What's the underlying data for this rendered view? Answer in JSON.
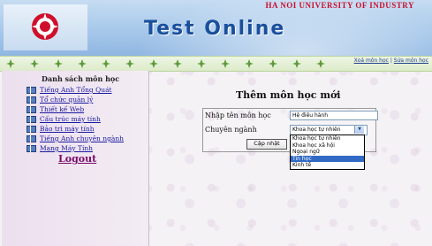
{
  "header": {
    "university": "HA NOI UNIVERSITY OF INDUSTRY",
    "title": "Test Online",
    "logo_icon": "university-logo-icon"
  },
  "top_nav": {
    "links": [
      "Xoá môn học",
      "Sửa môn học"
    ]
  },
  "sidebar": {
    "heading": "Danh sách môn học",
    "items": [
      {
        "label": "Tiếng Anh Tổng Quát",
        "icon": "book-icon"
      },
      {
        "label": "Tổ chức quản lý",
        "icon": "book-icon"
      },
      {
        "label": "Thiết kế Web",
        "icon": "book-icon"
      },
      {
        "label": "Cấu trúc máy tính",
        "icon": "book-icon"
      },
      {
        "label": "Bảo trì máy tính",
        "icon": "book-icon"
      },
      {
        "label": "Tiếng Anh chuyên ngành",
        "icon": "book-icon"
      },
      {
        "label": "Mạng Máy Tính",
        "icon": "book-icon"
      }
    ],
    "logout": "Logout"
  },
  "form": {
    "heading": "Thêm môn học mới",
    "name_label": "Nhập tên môn học",
    "name_value": "Hệ điều hành",
    "major_label": "Chuyên ngành",
    "major_selected": "Khoa học tự nhiên",
    "major_options": [
      "Khoa học tự nhiên",
      "Khoa học xã hội",
      "Ngoại ngữ",
      "Tin học",
      "Kinh tế"
    ],
    "major_highlighted_index": 3,
    "submit": "Cập nhật"
  },
  "colors": {
    "title": "#1a4f9c",
    "university": "#c8102e",
    "link": "#1a1aa0",
    "logout": "#7a0a6a",
    "highlight": "#316ac5"
  }
}
